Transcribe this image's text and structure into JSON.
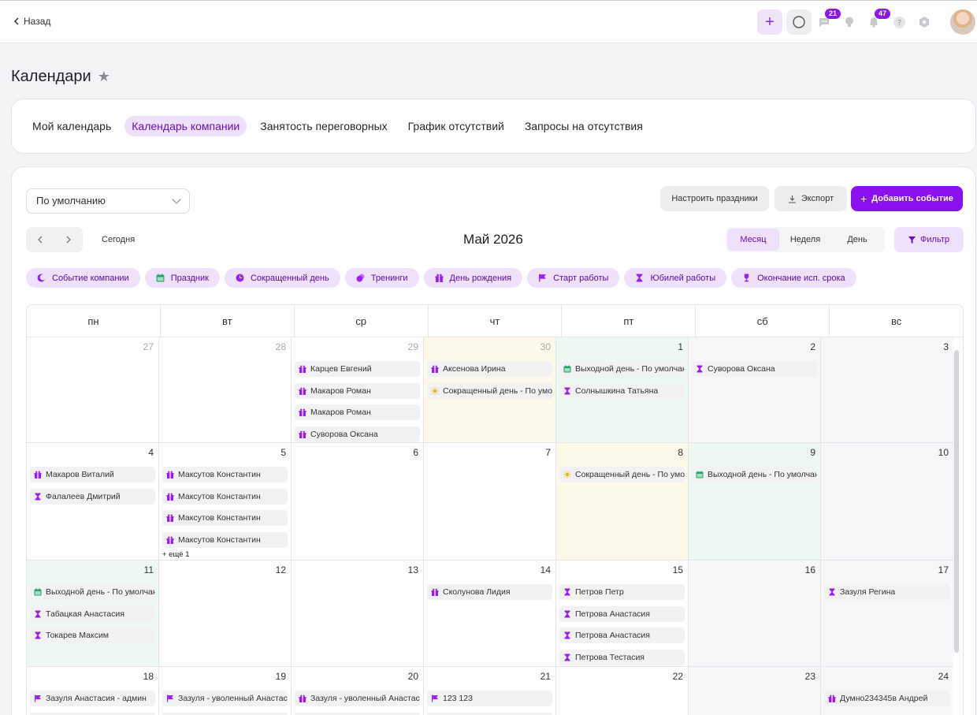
{
  "topbar": {
    "back_label": "Назад",
    "chat_badge": "21",
    "notify_badge": "47"
  },
  "page": {
    "title": "Календари"
  },
  "tabs": [
    {
      "label": "Мой календарь",
      "active": false
    },
    {
      "label": "Календарь компании",
      "active": true
    },
    {
      "label": "Занятость переговорных",
      "active": false
    },
    {
      "label": "График отсутствий",
      "active": false
    },
    {
      "label": "Запросы на отсутствия",
      "active": false
    }
  ],
  "toolbar": {
    "calendar_select": "По умолчанию",
    "holidays_label": "Настроить праздники",
    "export_label": "Экспорт",
    "add_label": "Добавить событие",
    "today_label": "Сегодня",
    "month_title": "Май 2026",
    "views": [
      {
        "label": "Месяц",
        "active": true
      },
      {
        "label": "Неделя",
        "active": false
      },
      {
        "label": "День",
        "active": false
      }
    ],
    "filter_label": "Фильтр"
  },
  "legend": [
    {
      "label": "Событие компании",
      "icon": "moon-icon"
    },
    {
      "label": "Праздник",
      "icon": "calendar-icon"
    },
    {
      "label": "Сокращенный день",
      "icon": "clock-icon"
    },
    {
      "label": "Тренинги",
      "icon": "training-icon"
    },
    {
      "label": "День рождения",
      "icon": "gift-icon"
    },
    {
      "label": "Старт работы",
      "icon": "flag-icon"
    },
    {
      "label": "Юбилей работы",
      "icon": "hourglass-icon"
    },
    {
      "label": "Окончание исп. срока",
      "icon": "trophy-icon"
    }
  ],
  "weekdays": [
    "пн",
    "вт",
    "ср",
    "чт",
    "пт",
    "сб",
    "вс"
  ],
  "colors": {
    "accent": "#8a10f0",
    "accent_light": "#efe0fb",
    "short_day_bg": "#fdf9e9",
    "off_day_bg": "#ecf8f1",
    "weekend_bg": "#f7f7f9",
    "icon_purple": "#9b1ff0",
    "icon_green": "#1fa36a",
    "icon_yellow": "#f2b51d"
  },
  "weeks": [
    [
      {
        "num": "27",
        "other": true,
        "events": []
      },
      {
        "num": "28",
        "other": true,
        "events": []
      },
      {
        "num": "29",
        "other": true,
        "events": [
          {
            "icon": "gift-icon",
            "text": "Карцев Евгений"
          },
          {
            "icon": "gift-icon",
            "text": "Макаров Роман"
          },
          {
            "icon": "gift-icon",
            "text": "Макаров Роман"
          },
          {
            "icon": "gift-icon",
            "text": "Суворова Оксана"
          }
        ]
      },
      {
        "num": "30",
        "other": true,
        "type": "short",
        "events": [
          {
            "icon": "gift-icon",
            "text": "Аксенова Ирина"
          },
          {
            "icon": "sun-icon",
            "text": "Сокращенный день - По умолчанию"
          }
        ]
      },
      {
        "num": "1",
        "type": "off",
        "events": [
          {
            "icon": "calendar-icon",
            "text": "Выходной день - По умолчанию"
          },
          {
            "icon": "hourglass-icon",
            "text": "Солнышкина Татьяна"
          }
        ]
      },
      {
        "num": "2",
        "type": "weekend",
        "events": [
          {
            "icon": "hourglass-icon",
            "text": "Суворова Оксана"
          }
        ]
      },
      {
        "num": "3",
        "type": "weekend",
        "events": []
      }
    ],
    [
      {
        "num": "4",
        "events": [
          {
            "icon": "gift-icon",
            "text": "Макаров Виталий"
          },
          {
            "icon": "hourglass-icon",
            "text": "Фалалеев Дмитрий"
          }
        ]
      },
      {
        "num": "5",
        "events": [
          {
            "icon": "gift-icon",
            "text": "Максутов Константин"
          },
          {
            "icon": "gift-icon",
            "text": "Максутов Константин"
          },
          {
            "icon": "gift-icon",
            "text": "Максутов Константин"
          },
          {
            "icon": "gift-icon",
            "text": "Максутов Константин"
          }
        ],
        "more": "+ ещё 1"
      },
      {
        "num": "6",
        "events": []
      },
      {
        "num": "7",
        "events": []
      },
      {
        "num": "8",
        "type": "short",
        "events": [
          {
            "icon": "sun-icon",
            "text": "Сокращенный день - По умолчанию"
          }
        ]
      },
      {
        "num": "9",
        "type": "off",
        "events": [
          {
            "icon": "calendar-icon",
            "text": "Выходной день - По умолчанию"
          }
        ]
      },
      {
        "num": "10",
        "type": "weekend",
        "events": []
      }
    ],
    [
      {
        "num": "11",
        "type": "off",
        "events": [
          {
            "icon": "calendar-icon",
            "text": "Выходной день - По умолчанию"
          },
          {
            "icon": "hourglass-icon",
            "text": "Табацкая Анастасия"
          },
          {
            "icon": "hourglass-icon",
            "text": "Токарев Максим"
          }
        ]
      },
      {
        "num": "12",
        "events": []
      },
      {
        "num": "13",
        "events": []
      },
      {
        "num": "14",
        "events": [
          {
            "icon": "gift-icon",
            "text": "Сколунова Лидия"
          }
        ]
      },
      {
        "num": "15",
        "events": [
          {
            "icon": "hourglass-icon",
            "text": "Петров Петр"
          },
          {
            "icon": "hourglass-icon",
            "text": "Петрова Анастасия"
          },
          {
            "icon": "hourglass-icon",
            "text": "Петрова Анастасия"
          },
          {
            "icon": "hourglass-icon",
            "text": "Петрова Тестасия"
          }
        ]
      },
      {
        "num": "16",
        "type": "weekend",
        "events": []
      },
      {
        "num": "17",
        "type": "weekend",
        "events": [
          {
            "icon": "hourglass-icon",
            "text": "Зазуля Регина"
          }
        ]
      }
    ],
    [
      {
        "num": "18",
        "events": [
          {
            "icon": "flag-icon",
            "text": "Зазуля Анастасия - админ"
          },
          {
            "icon": "flag-icon",
            "text": ""
          }
        ]
      },
      {
        "num": "19",
        "events": [
          {
            "icon": "flag-icon",
            "text": "Зазуля - уволенный Анастасия"
          },
          {
            "icon": "flag-icon",
            "text": ""
          }
        ]
      },
      {
        "num": "20",
        "events": [
          {
            "icon": "gift-icon",
            "text": "Зазуля - уволенный Анастасия"
          },
          {
            "icon": "gift-icon",
            "text": ""
          }
        ]
      },
      {
        "num": "21",
        "events": [
          {
            "icon": "flag-icon",
            "text": "123 123"
          },
          {
            "icon": "flag-icon",
            "text": ""
          }
        ]
      },
      {
        "num": "22",
        "events": []
      },
      {
        "num": "23",
        "type": "weekend",
        "events": []
      },
      {
        "num": "24",
        "type": "weekend",
        "events": [
          {
            "icon": "gift-icon",
            "text": "Думно234345в Андрей"
          }
        ]
      }
    ]
  ]
}
